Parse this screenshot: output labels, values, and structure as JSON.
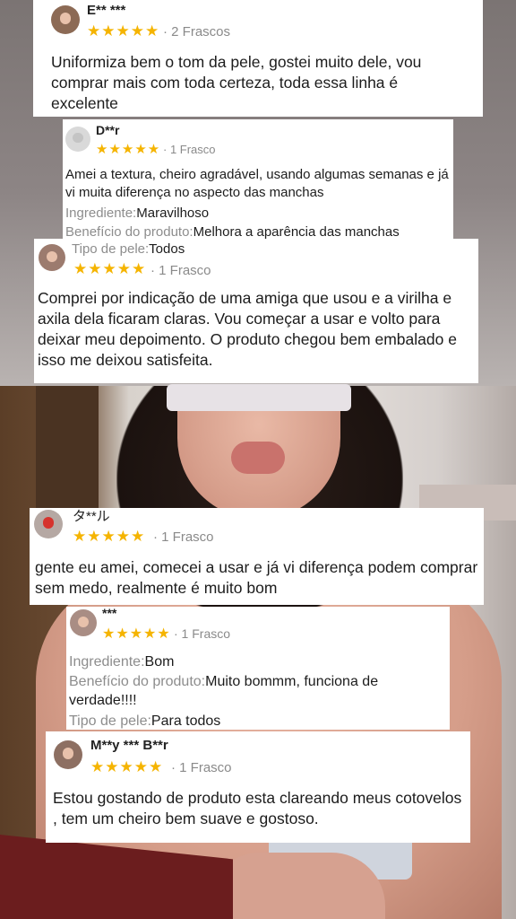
{
  "colors": {
    "star": "#f5b400",
    "muted": "#8a8a8a",
    "card_bg": "#ffffff"
  },
  "reviews": [
    {
      "name": "E** ***",
      "stars": "★★★★★",
      "meta": "· 2 Frascos",
      "text": "Uniformiza bem o tom da pele, gostei muito dele, vou comprar mais com toda certeza, toda essa linha é excelente"
    },
    {
      "name": "D**r",
      "stars": "★★★★★",
      "meta": "· 1 Frasco",
      "text": "Amei a textura, cheiro agradável, usando algumas semanas e já vi muita diferença no aspecto das manchas",
      "fields": [
        {
          "label": "Ingrediente:",
          "value": "Maravilhoso"
        },
        {
          "label": "Benefício do produto:",
          "value": "Melhora a aparência das manchas"
        }
      ]
    },
    {
      "name": "",
      "stars": "★★★★★",
      "meta": "· 1 Frasco",
      "fields": [
        {
          "label": "Tipo de pele:",
          "value": "Todos"
        }
      ],
      "text": "Comprei por indicação de uma amiga que usou e a virilha e axila dela ficaram claras. Vou começar a usar e volto para deixar meu depoimento. O produto chegou bem embalado e isso me deixou satisfeita."
    },
    {
      "name": "タ**ル",
      "stars": "★★★★★",
      "meta": "· 1 Frasco",
      "text": "gente eu amei, comecei a usar e já vi diferença podem comprar sem medo, realmente é muito bom"
    },
    {
      "name": "***",
      "stars": "★★★★★",
      "meta": "· 1 Frasco",
      "fields": [
        {
          "label": "Ingrediente:",
          "value": "Bom"
        },
        {
          "label": "Benefício do produto:",
          "value": "Muito bommm, funciona de verdade!!!!"
        },
        {
          "label": "Tipo de pele:",
          "value": "Para todos"
        }
      ]
    },
    {
      "name": "M**y *** B**r",
      "stars": "★★★★★",
      "meta": "· 1 Frasco",
      "text": "Estou gostando de produto esta clareando meus cotovelos , tem um cheiro bem suave e gostoso."
    }
  ]
}
